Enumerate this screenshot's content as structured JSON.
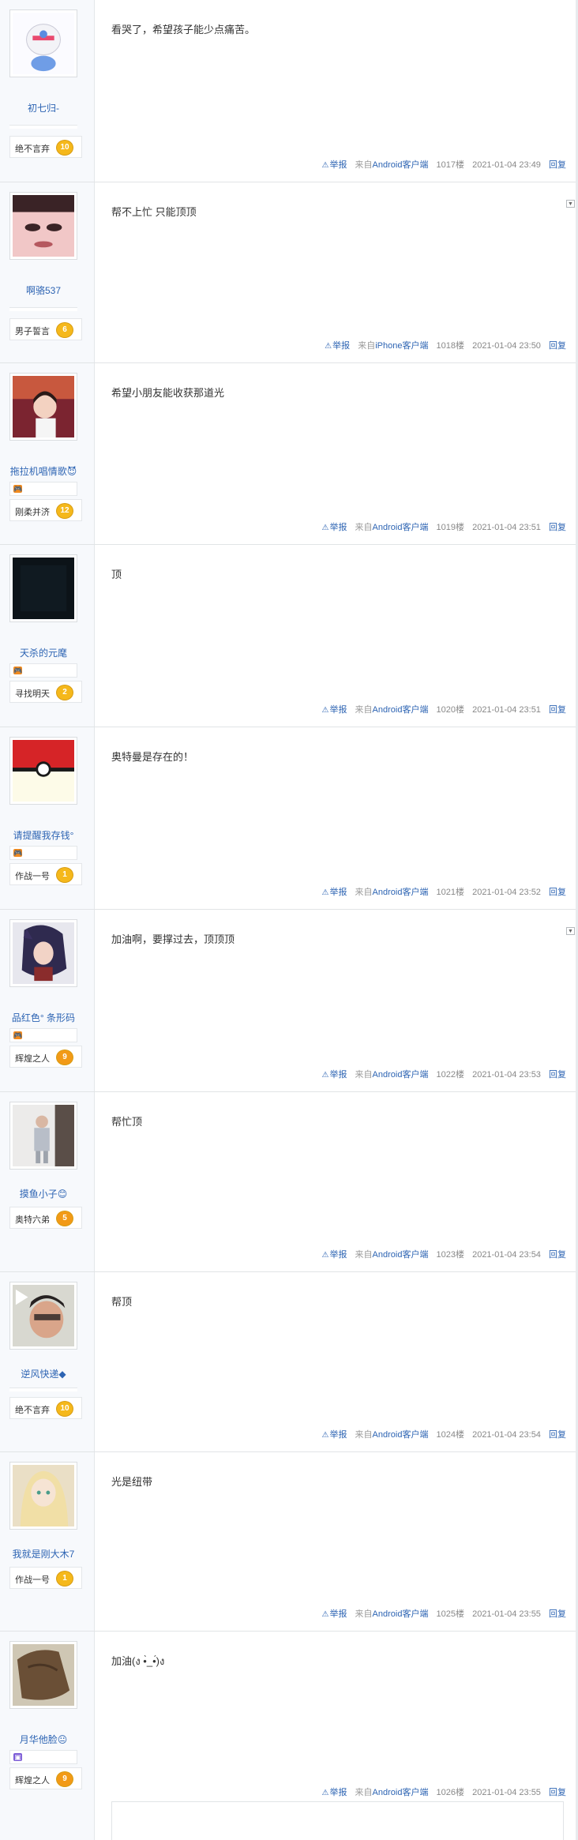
{
  "posts": [
    {
      "username": "初七归-",
      "level_name": "绝不言弃",
      "level_num": "10",
      "content": "看哭了，希望孩子能少点痛苦。",
      "report": "举报",
      "source_prefix": "来自",
      "source_client": "Android客户端",
      "floor": "1017楼",
      "time": "2021-01-04 23:49",
      "reply": "回复",
      "badge": false,
      "dropdown": false
    },
    {
      "username": "啊骆537",
      "level_name": "男子誓言",
      "level_num": "6",
      "content": "帮不上忙 只能顶顶",
      "report": "举报",
      "source_prefix": "来自",
      "source_client": "iPhone客户端",
      "floor": "1018楼",
      "time": "2021-01-04 23:50",
      "reply": "回复",
      "badge": false,
      "dropdown": true
    },
    {
      "username": "拖拉机唱情歌😈",
      "level_name": "刚柔并济",
      "level_num": "12",
      "content": "希望小朋友能收获那道光",
      "report": "举报",
      "source_prefix": "来自",
      "source_client": "Android客户端",
      "floor": "1019楼",
      "time": "2021-01-04 23:51",
      "reply": "回复",
      "badge": true,
      "dropdown": false
    },
    {
      "username": "天杀的元麾",
      "level_name": "寻找明天",
      "level_num": "2",
      "content": "顶",
      "report": "举报",
      "source_prefix": "来自",
      "source_client": "Android客户端",
      "floor": "1020楼",
      "time": "2021-01-04 23:51",
      "reply": "回复",
      "badge": true,
      "dropdown": false
    },
    {
      "username": "请提醒我存钱°",
      "level_name": "作战一号",
      "level_num": "1",
      "content": "奥特曼是存在的！",
      "report": "举报",
      "source_prefix": "来自",
      "source_client": "Android客户端",
      "floor": "1021楼",
      "time": "2021-01-04 23:52",
      "reply": "回复",
      "badge": true,
      "dropdown": false
    },
    {
      "username": "品红色° 条形码",
      "level_name": "辉煌之人",
      "level_num": "9",
      "content": "加油啊，要撑过去，顶顶顶",
      "report": "举报",
      "source_prefix": "来自",
      "source_client": "Android客户端",
      "floor": "1022楼",
      "time": "2021-01-04 23:53",
      "reply": "回复",
      "badge": true,
      "dropdown": true
    },
    {
      "username": "摸鱼小子😊",
      "level_name": "奥特六弟",
      "level_num": "5",
      "content": "帮忙顶",
      "report": "举报",
      "source_prefix": "来自",
      "source_client": "Android客户端",
      "floor": "1023楼",
      "time": "2021-01-04 23:54",
      "reply": "回复",
      "badge": false,
      "dropdown": false
    },
    {
      "username": "逆风快递◆",
      "level_name": "绝不言弃",
      "level_num": "10",
      "content": "帮顶",
      "report": "举报",
      "source_prefix": "来自",
      "source_client": "Android客户端",
      "floor": "1024楼",
      "time": "2021-01-04 23:54",
      "reply": "回复",
      "badge": false,
      "dropdown": false
    },
    {
      "username": "我就是刚大木7",
      "level_name": "作战一号",
      "level_num": "1",
      "content": "光是纽带",
      "report": "举报",
      "source_prefix": "来自",
      "source_client": "Android客户端",
      "floor": "1025楼",
      "time": "2021-01-04 23:55",
      "reply": "回复",
      "badge": false,
      "dropdown": false
    },
    {
      "username": "月华他脸😐",
      "level_name": "辉煌之人",
      "level_num": "9",
      "content": "加油(ง •̀_•́)ง",
      "report": "举报",
      "source_prefix": "来自",
      "source_client": "Android客户端",
      "floor": "1026楼",
      "time": "2021-01-04 23:55",
      "reply": "回复",
      "badge": true,
      "dropdown": false
    }
  ],
  "colors": {
    "link": "#2d64b3",
    "level_gold": "#f5b81b",
    "level_orange": "#f29a17",
    "sidebar_bg": "#f7f9fc"
  }
}
